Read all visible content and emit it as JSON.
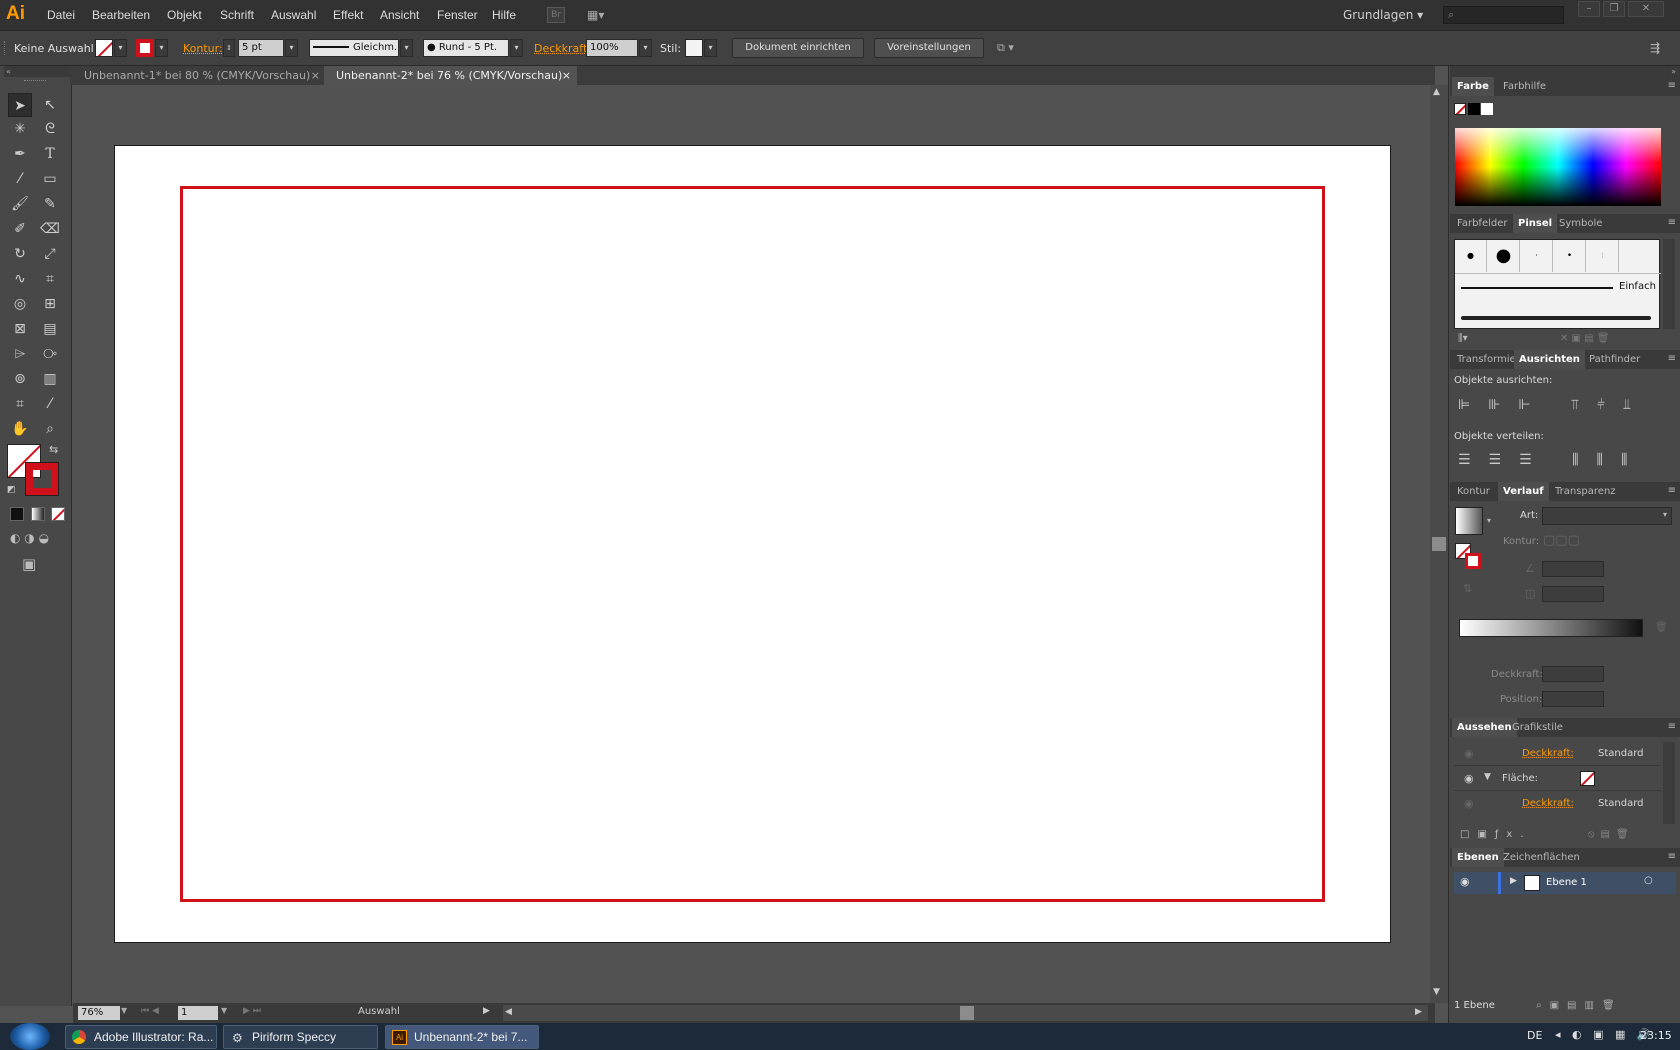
{
  "app": {
    "logo": "Ai",
    "workspace": "Grundlagen",
    "search_placeholder": ""
  },
  "menu": [
    "Datei",
    "Bearbeiten",
    "Objekt",
    "Schrift",
    "Auswahl",
    "Effekt",
    "Ansicht",
    "Fenster",
    "Hilfe"
  ],
  "bridge_label": "Br",
  "control": {
    "selection": "Keine Auswahl",
    "stroke_label": "Kontur:",
    "stroke_weight": "5 pt",
    "stroke_profile": "Gleichm.",
    "brush": "Rund - 5 Pt.",
    "opacity_label": "Deckkraft:",
    "opacity": "100%",
    "style_label": "Stil:",
    "doc_setup": "Dokument einrichten",
    "preferences": "Voreinstellungen"
  },
  "tabs": [
    {
      "label": "Unbenannt-1* bei 80 % (CMYK/Vorschau)"
    },
    {
      "label": "Unbenannt-2* bei 76 % (CMYK/Vorschau)"
    }
  ],
  "colors": {
    "stroke": "#d0111c",
    "accent": "#ff9a00"
  },
  "status": {
    "zoom": "76%",
    "artboard": "1",
    "tool": "Auswahl"
  },
  "panels": {
    "color": {
      "tabs": [
        "Farbe",
        "Farbhilfe"
      ]
    },
    "brushes": {
      "tabs": [
        "Farbfelder",
        "Pinsel",
        "Symbole"
      ],
      "stroke_name": "Einfach"
    },
    "align": {
      "tabs": [
        "Transformie",
        "Ausrichten",
        "Pathfinder"
      ],
      "align_objects": "Objekte ausrichten:",
      "distribute_objects": "Objekte verteilen:"
    },
    "gradient": {
      "tabs": [
        "Kontur",
        "Verlauf",
        "Transparenz"
      ],
      "type_label": "Art:",
      "stroke_label": "Kontur:",
      "opacity_label": "Deckkraft:",
      "position_label": "Position:"
    },
    "appearance": {
      "tabs": [
        "Aussehen",
        "Grafikstile"
      ],
      "rows": [
        {
          "label": "Deckkraft:",
          "value": "Standard"
        },
        {
          "label": "Fläche:",
          "value": ""
        },
        {
          "label": "Deckkraft:",
          "value": "Standard"
        }
      ]
    },
    "layers": {
      "tabs": [
        "Ebenen",
        "Zeichenflächen"
      ],
      "layer_name": "Ebene 1",
      "count": "1 Ebene"
    }
  },
  "taskbar": {
    "items": [
      "Adobe Illustrator: Ra...",
      "Piriform Speccy",
      "Unbenannt-2* bei 7..."
    ],
    "lang": "DE",
    "time": "23:15"
  }
}
